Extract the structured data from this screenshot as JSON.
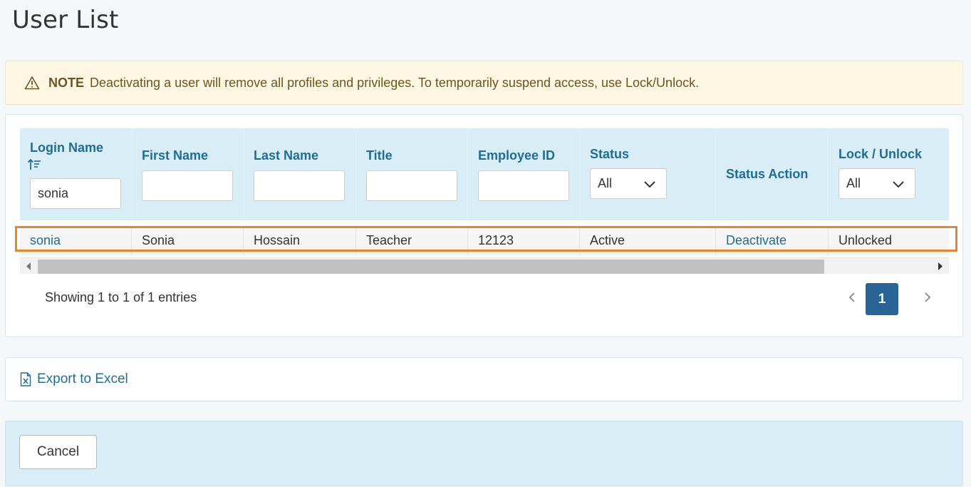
{
  "page_title": "User List",
  "note": {
    "icon": "warning-triangle-icon",
    "label": "NOTE",
    "text": "Deactivating a user will remove all profiles and privileges. To temporarily suspend access, use Lock/Unlock."
  },
  "table": {
    "columns": [
      {
        "label": "Login Name",
        "filter": "sonia",
        "sorted": "ascending"
      },
      {
        "label": "First Name",
        "filter": ""
      },
      {
        "label": "Last Name",
        "filter": ""
      },
      {
        "label": "Title",
        "filter": ""
      },
      {
        "label": "Employee ID",
        "filter": ""
      },
      {
        "label": "Status",
        "select": "All"
      },
      {
        "label": "Status Action"
      },
      {
        "label": "Lock / Unlock",
        "select": "All"
      }
    ],
    "rows": [
      {
        "login_name": "sonia",
        "first_name": "Sonia",
        "last_name": "Hossain",
        "title": "Teacher",
        "employee_id": "12123",
        "status": "Active",
        "status_action": "Deactivate",
        "lock_unlock": "Unlocked"
      }
    ],
    "highlight_color": "#e8862d"
  },
  "pagination": {
    "summary": "Showing 1 to 1 of 1 entries",
    "current_page": "1"
  },
  "export": {
    "label": "Export to Excel",
    "icon": "excel-file-icon"
  },
  "footer": {
    "cancel_label": "Cancel"
  },
  "colors": {
    "accent": "#1f6d95",
    "active_page": "#2a6496",
    "note_bg": "#fdf6e3",
    "header_bg": "#d9edf7"
  }
}
